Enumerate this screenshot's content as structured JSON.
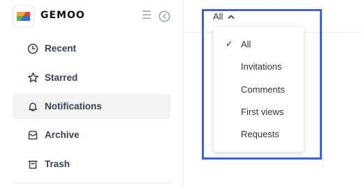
{
  "brand": {
    "name": "GEMOO"
  },
  "sidebar": {
    "items": [
      {
        "label": "Recent",
        "icon": "clock-icon",
        "active": false
      },
      {
        "label": "Starred",
        "icon": "star-icon",
        "active": false
      },
      {
        "label": "Notifications",
        "icon": "bell-icon",
        "active": true
      },
      {
        "label": "Archive",
        "icon": "archive-icon",
        "active": false
      },
      {
        "label": "Trash",
        "icon": "trash-icon",
        "active": false
      }
    ]
  },
  "filter": {
    "selected": "All",
    "options": [
      "All",
      "Invitations",
      "Comments",
      "First views",
      "Requests"
    ]
  },
  "colors": {
    "highlight": "#3b63e6",
    "active_bg": "#f3f3f3"
  }
}
